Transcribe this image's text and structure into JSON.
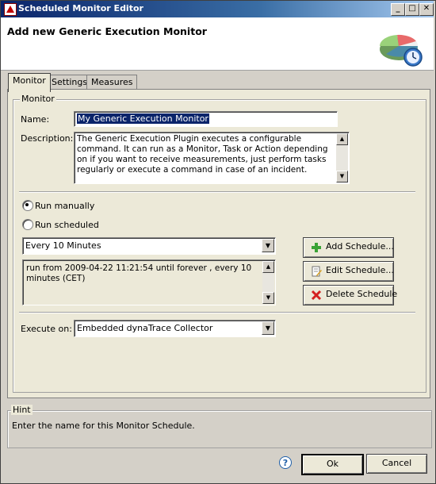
{
  "window": {
    "title": "Scheduled Monitor Editor",
    "minimize_glyph": "_",
    "maximize_glyph": "□",
    "close_glyph": "✕"
  },
  "header": {
    "title": "Add new Generic Execution Monitor",
    "art_icon": "pie-chart-clock-icon"
  },
  "tabs": [
    {
      "label": "Monitor",
      "active": true
    },
    {
      "label": "Settings",
      "active": false
    },
    {
      "label": "Measures",
      "active": false
    }
  ],
  "monitor_group": {
    "legend": "Monitor",
    "name_label": "Name:",
    "name_value": "My Generic Execution Monitor",
    "description_label": "Description:",
    "description_value": "The Generic Execution Plugin executes a configurable command. It can run as a Monitor, Task or Action depending on if you want to receive measurements, just perform tasks regularly or execute a command in case of an incident."
  },
  "schedule": {
    "run_manually_label": "Run manually",
    "run_scheduled_label": "Run scheduled",
    "selected": "manual",
    "schedule_select_value": "Every 10 Minutes",
    "schedule_detail": "run from 2009-04-22 11:21:54 until forever , every 10 minutes (CET)",
    "add_label": "Add Schedule...",
    "edit_label": "Edit Schedule...",
    "delete_label": "Delete Schedule"
  },
  "execute": {
    "label": "Execute on:",
    "value": "Embedded dynaTrace Collector"
  },
  "hint": {
    "legend": "Hint",
    "text": "Enter the name for this Monitor Schedule."
  },
  "footer": {
    "help_glyph": "?",
    "ok_label": "Ok",
    "cancel_label": "Cancel"
  },
  "colors": {
    "title_bar": "#0a246a",
    "selection": "#0a246a",
    "add_icon": "#3aa335",
    "delete_icon": "#d42020"
  }
}
